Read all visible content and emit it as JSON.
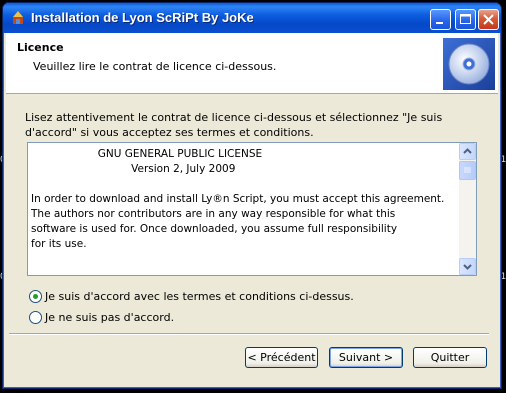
{
  "window": {
    "title": "Installation de Lyon ScRiPt By JoKe"
  },
  "header": {
    "title": "Licence",
    "subtitle": "Veuillez lire le contrat de licence ci-dessous."
  },
  "instructions": "Lisez attentivement le contrat de licence ci-dessous et sélectionnez \"Je suis d'accord\" si vous acceptez ses termes et conditions.",
  "license": {
    "text": "                    GNU GENERAL PUBLIC LICENSE\n                              Version 2, July 2009\n\nIn order to download and install Ly®n Script, you must accept this agreement.\nThe authors nor contributors are in any way responsible for what this\nsoftware is used for. Once downloaded, you assume full responsibility\nfor its use."
  },
  "options": {
    "accept_label": "Je suis d'accord avec les termes et conditions ci-dessus.",
    "decline_label": "Je ne suis pas d'accord.",
    "selected": "accept"
  },
  "buttons": {
    "previous": "< Précédent",
    "next": "Suivant >",
    "quit": "Quitter"
  },
  "colors": {
    "titlebar": "#0a5ad8",
    "accent_radio": "#21a121"
  }
}
